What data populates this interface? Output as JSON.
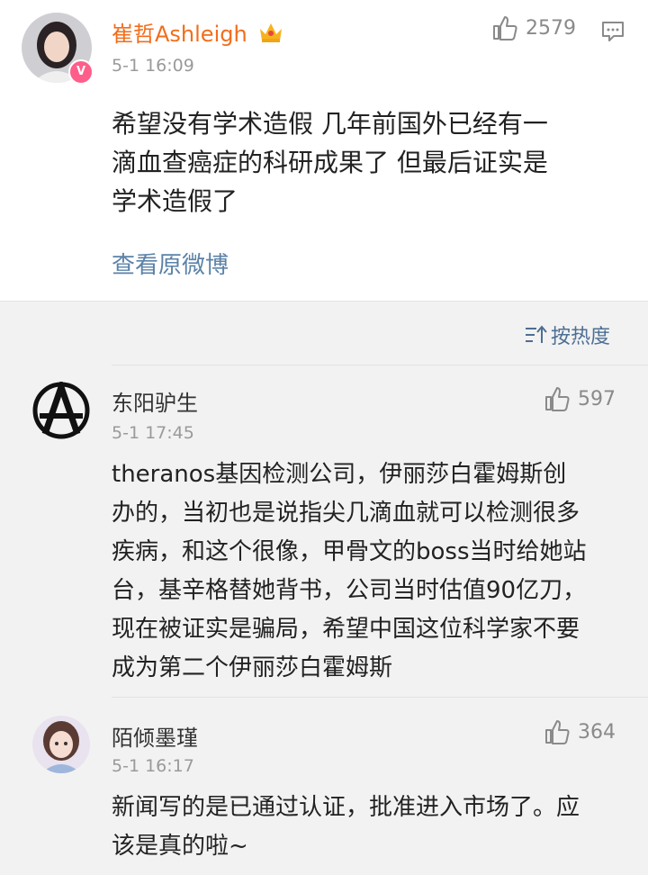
{
  "main_post": {
    "user": "崔哲Ashleigh",
    "time": "5-1 16:09",
    "likes": "2579",
    "content_lines": [
      "希望没有学术造假 几年前国外已经有一",
      "滴血查癌症的科研成果了 但最后证实是",
      "学术造假了"
    ],
    "view_original": "查看原微博"
  },
  "sort": {
    "label": "按热度"
  },
  "comments": [
    {
      "user": "东阳驴生",
      "time": "5-1 17:45",
      "likes": "597",
      "lines": [
        "theranos基因检测公司，伊丽莎白霍姆斯创",
        "办的，当初也是说指尖几滴血就可以检测很多",
        "疾病，和这个很像，甲骨文的boss当时给她站",
        "台，基辛格替她背书，公司当时估值90亿刀，",
        "现在被证实是骗局，希望中国这位科学家不要",
        "成为第二个伊丽莎白霍姆斯"
      ]
    },
    {
      "user": "陌倾墨瑾",
      "time": "5-1 16:17",
      "likes": "364",
      "lines": [
        "新闻写的是已通过认证，批准进入市场了。应",
        "该是真的啦~"
      ]
    }
  ],
  "colors": {
    "vip_name": "#f26d1b",
    "link": "#5b82a8",
    "badge": "#ff5e8a"
  }
}
